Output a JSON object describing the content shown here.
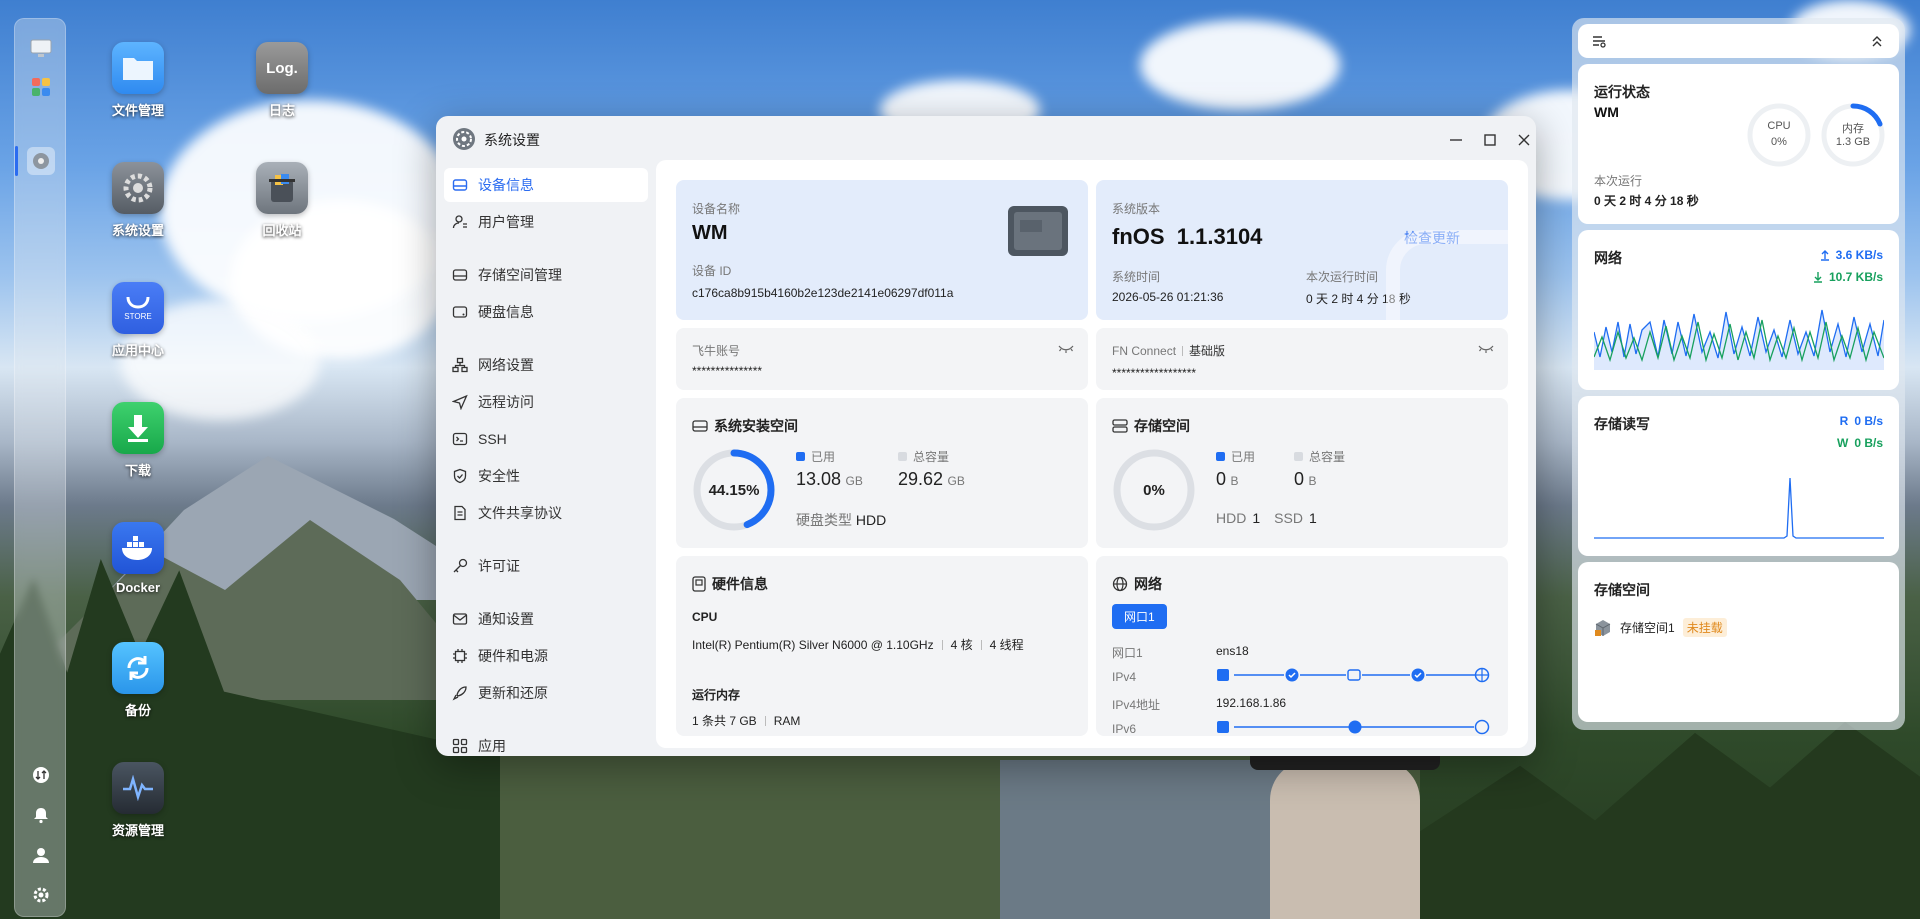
{
  "desktop": {
    "icons": [
      {
        "label": "文件管理"
      },
      {
        "label": "日志"
      },
      {
        "label": "系统设置"
      },
      {
        "label": "回收站"
      },
      {
        "label": "应用中心"
      },
      {
        "label": "下载"
      },
      {
        "label": "Docker"
      },
      {
        "label": "备份"
      },
      {
        "label": "资源管理"
      }
    ],
    "log_tile_text": "Log.",
    "store_tile_text": "STORE"
  },
  "window": {
    "title": "系统设置",
    "sidebar": [
      {
        "label": "设备信息"
      },
      {
        "label": "用户管理"
      },
      {
        "label": "存储空间管理"
      },
      {
        "label": "硬盘信息"
      },
      {
        "label": "网络设置"
      },
      {
        "label": "远程访问"
      },
      {
        "label": "SSH"
      },
      {
        "label": "安全性"
      },
      {
        "label": "文件共享协议"
      },
      {
        "label": "许可证"
      },
      {
        "label": "通知设置"
      },
      {
        "label": "硬件和电源"
      },
      {
        "label": "更新和还原"
      },
      {
        "label": "应用"
      }
    ],
    "device": {
      "name_label": "设备名称",
      "name": "WM",
      "id_label": "设备 ID",
      "id": "c176ca8b915b4160b2e123de2141e06297df011a"
    },
    "version": {
      "label": "系统版本",
      "value": "fnOS  1.1.3104",
      "check_update": "检查更新",
      "time_label": "系统时间",
      "time": "2026-05-26 01:21:36",
      "uptime_label": "本次运行时间",
      "uptime": "0 天 2 时 4 分 18 秒"
    },
    "account": {
      "label": "飞牛账号",
      "value": "***************"
    },
    "fnconnect": {
      "label": "FN Connect",
      "edition": "基础版",
      "value": "******************"
    },
    "sys_space": {
      "title": "系统安装空间",
      "percent": "44.15%",
      "percent_value": 44.15,
      "used_label": "已用",
      "used": "13.08",
      "used_unit": "GB",
      "total_label": "总容量",
      "total": "29.62",
      "total_unit": "GB",
      "disk_type_label": "硬盘类型",
      "disk_type": "HDD"
    },
    "storage": {
      "title": "存储空间",
      "percent": "0%",
      "used_label": "已用",
      "used": "0",
      "used_unit": "B",
      "total_label": "总容量",
      "total": "0",
      "total_unit": "B",
      "hdd_label": "HDD",
      "hdd": "1",
      "ssd_label": "SSD",
      "ssd": "1"
    },
    "hardware": {
      "title": "硬件信息",
      "cpu_label": "CPU",
      "cpu": "Intel(R) Pentium(R) Silver N6000 @ 1.10GHz",
      "cores": "4 核",
      "threads": "4 线程",
      "mem_label": "运行内存",
      "mem": "1 条共 7 GB",
      "mem_type": "RAM"
    },
    "network": {
      "title": "网络",
      "port_tab": "网口1",
      "port_label": "网口1",
      "port": "ens18",
      "ipv4_label": "IPv4",
      "ipv4_addr_label": "IPv4地址",
      "ipv4_addr": "192.168.1.86",
      "ipv6_label": "IPv6"
    }
  },
  "right_panel": {
    "status": {
      "title": "运行状态",
      "host": "WM",
      "cpu_label": "CPU",
      "cpu": "0%",
      "mem_label": "内存",
      "mem": "1.3 GB",
      "uptime_label": "本次运行",
      "uptime": "0 天 2 时 4 分 18 秒"
    },
    "network": {
      "title": "网络",
      "up": "3.6 KB/s",
      "down": "10.7 KB/s"
    },
    "disk_io": {
      "title": "存储读写",
      "read_label": "R",
      "read": "0 B/s",
      "write_label": "W",
      "write": "0 B/s"
    },
    "storage": {
      "title": "存储空间",
      "item": "存储空间1",
      "status": "未挂载"
    }
  },
  "colors": {
    "accent": "#2b6cf0",
    "green": "#17a05d",
    "warning": "#e08a1e"
  }
}
